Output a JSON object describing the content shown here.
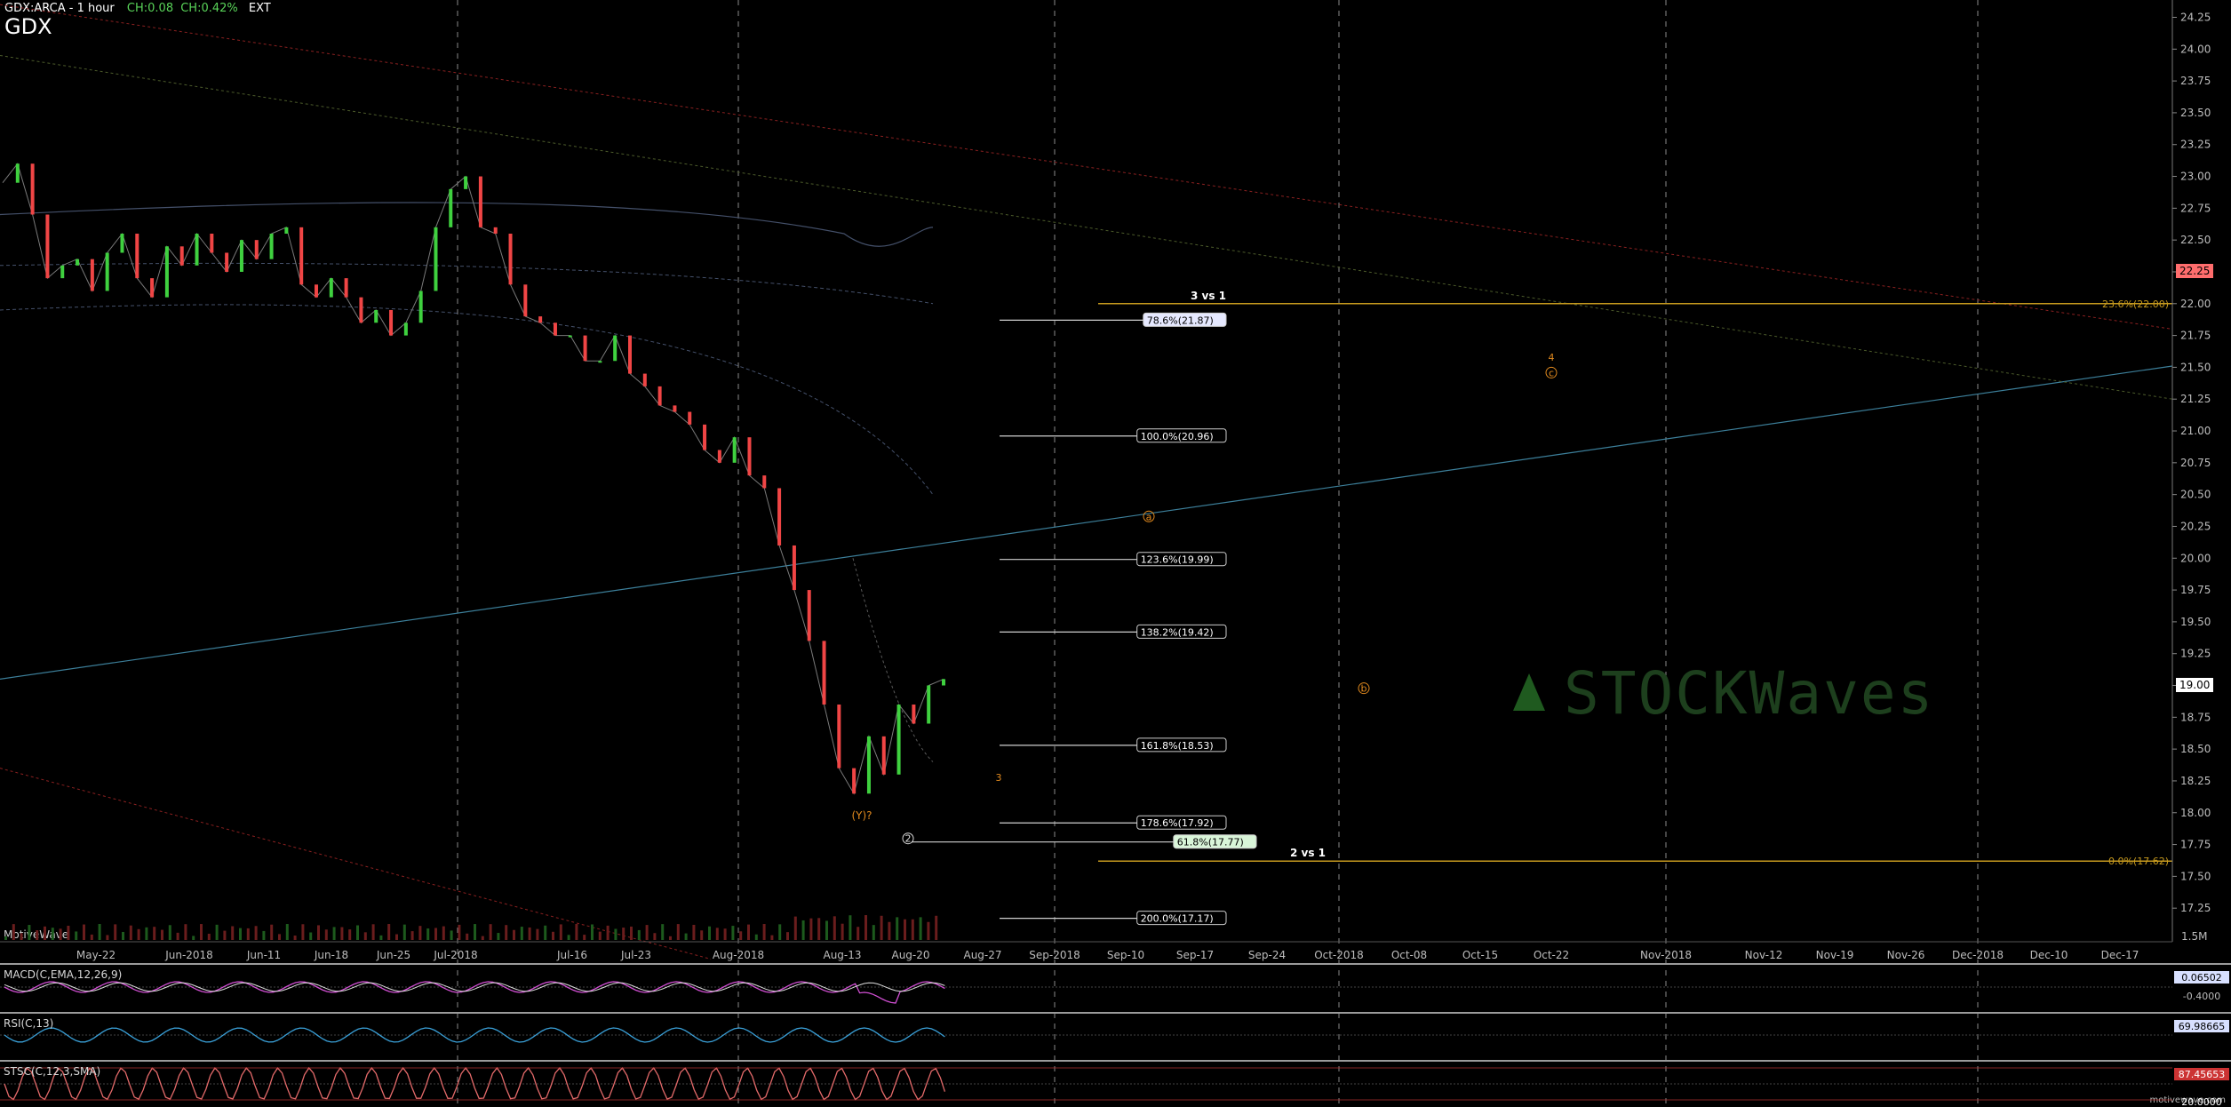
{
  "header": {
    "title": "GDX:ARCA - 1 hour",
    "ch_abs": "CH:0.08",
    "ch_pct": "CH:0.42%",
    "session": "EXT",
    "symbol": "GDX",
    "provider": "MotiveWave",
    "footer": "motivewave.com"
  },
  "chart_data": {
    "type": "line",
    "y_axis": {
      "range": [
        17.0,
        24.4
      ],
      "ticks": [
        "24.25",
        "24.00",
        "23.75",
        "23.50",
        "23.25",
        "23.00",
        "22.75",
        "22.50",
        "22.25",
        "22.00",
        "21.75",
        "21.50",
        "21.25",
        "21.00",
        "20.75",
        "20.50",
        "20.25",
        "20.00",
        "19.75",
        "19.50",
        "19.25",
        "19.00",
        "18.75",
        "18.50",
        "18.25",
        "18.00",
        "17.75",
        "17.50",
        "17.25"
      ]
    },
    "x_axis_labels": [
      "May-22",
      "Jun-2018",
      "Jun-11",
      "Jun-18",
      "Jun-25",
      "Jul-2018",
      "Jul-16",
      "Jul-23",
      "Aug-2018",
      "Aug-13",
      "Aug-20",
      "Aug-27",
      "Sep-2018",
      "Sep-10",
      "Sep-17",
      "Sep-24",
      "Oct-2018",
      "Oct-08",
      "Oct-15",
      "Oct-22",
      "Nov-2018",
      "Nov-12",
      "Nov-19",
      "Nov-26",
      "Dec-2018",
      "Dec-10",
      "Dec-17"
    ],
    "price_series": [
      22.95,
      23.1,
      22.7,
      22.2,
      22.3,
      22.35,
      22.1,
      22.4,
      22.55,
      22.2,
      22.05,
      22.45,
      22.3,
      22.55,
      22.4,
      22.25,
      22.5,
      22.35,
      22.55,
      22.6,
      22.15,
      22.05,
      22.2,
      22.05,
      21.85,
      21.95,
      21.75,
      21.85,
      22.1,
      22.6,
      22.9,
      23.0,
      22.6,
      22.55,
      22.15,
      21.9,
      21.85,
      21.75,
      21.75,
      21.55,
      21.55,
      21.75,
      21.45,
      21.35,
      21.2,
      21.15,
      21.05,
      20.85,
      20.75,
      20.95,
      20.65,
      20.55,
      20.1,
      19.75,
      19.35,
      18.85,
      18.35,
      18.15,
      18.6,
      18.3,
      18.85,
      18.7,
      19.0,
      19.05
    ],
    "fib_levels": [
      {
        "label": "78.6%(21.87)",
        "value": 21.87,
        "highlight": "blue"
      },
      {
        "label": "100.0%(20.96)",
        "value": 20.96
      },
      {
        "label": "123.6%(19.99)",
        "value": 19.99
      },
      {
        "label": "138.2%(19.42)",
        "value": 19.42
      },
      {
        "label": "161.8%(18.53)",
        "value": 18.53
      },
      {
        "label": "178.6%(17.92)",
        "value": 17.92
      },
      {
        "label": "61.8%(17.77)",
        "value": 17.77,
        "highlight": "green"
      },
      {
        "label": "200.0%(17.17)",
        "value": 17.17
      }
    ],
    "gold_levels": [
      {
        "label": "23.6%(22.00)",
        "value": 22.0,
        "note": "3 vs 1"
      },
      {
        "label": "0.0%(17.62)",
        "value": 17.62,
        "note": "2 vs 1"
      }
    ],
    "wave_labels": [
      {
        "text": "(Y)?",
        "value": 17.95
      },
      {
        "text": "2",
        "value": 17.77
      },
      {
        "text": "3",
        "value": 18.25
      },
      {
        "text": "a",
        "value": 20.3
      },
      {
        "text": "b",
        "value": 18.95
      },
      {
        "text": "4",
        "value": 21.55
      },
      {
        "text": "c",
        "value": 21.43
      }
    ],
    "last_price_tags": [
      {
        "label": "22.25",
        "value": 22.25,
        "color": "#ff6d6d"
      },
      {
        "label": "19.00",
        "value": 19.0,
        "color": "#ffffff"
      }
    ],
    "volume_label": "1.5M",
    "indicators": [
      {
        "name": "MACD(C,EMA,12,26,9)",
        "value": "0.06502",
        "mid_tick": "-0.4000"
      },
      {
        "name": "RSI(C,13)",
        "value": "69.98665"
      },
      {
        "name": "STSC(C,12,3,SMA)",
        "value": "87.45653",
        "low_tick": "20.0000"
      }
    ],
    "watermark": "STOCKWaves"
  },
  "colors": {
    "background": "#000000",
    "gold": "#c79a1e",
    "wave_orange": "#e28a1e",
    "trend_blue": "#3c7f9a",
    "trend_red": "#8a2020",
    "macd": "#d24fd4",
    "rsi": "#3aa0d8",
    "stoch": "#e46a6a"
  }
}
